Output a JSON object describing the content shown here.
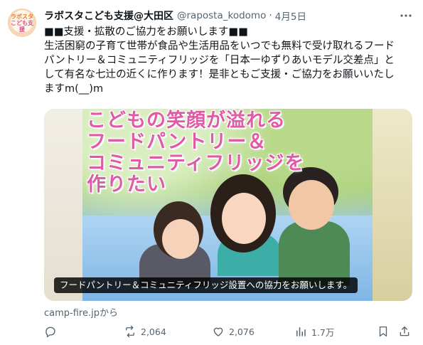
{
  "account": {
    "avatar_text_line1": "ラボスタ",
    "avatar_text_line2": "こども支援",
    "display_name": "ラボスタこども支援@大田区",
    "handle": "@raposta_kodomo",
    "separator": "·",
    "date": "4月5日"
  },
  "post": {
    "lines": [
      "■■支援・拡散のご協力をお願いします■■",
      "生活困窮の子育て世帯が食品や生活用品をいつでも無料で受け取れるフード",
      "パントリー＆コミュニティフリッジを「日本一ゆずりあいモデル交差点」と",
      "して有名な七辻の近くに作ります！是非ともご支援・ご協力をお願いいたし",
      "ますm(__)m"
    ]
  },
  "media": {
    "headline": "こどもの笑顔が溢れる\nフードパントリー＆\nコミュニティフリッジを\n作りたい",
    "caption": "フードパントリー＆コミュニティフリッジ設置への協力をお願いします。",
    "headline_color": "#e05ba6"
  },
  "source_text": "camp-fire.jpから",
  "actions": {
    "reply": {
      "icon": "reply-icon"
    },
    "retweet": {
      "icon": "retweet-icon",
      "count": "2,064"
    },
    "like": {
      "icon": "like-icon",
      "count": "2,076"
    },
    "views": {
      "icon": "views-icon",
      "count": "1.7万"
    },
    "bookmark": {
      "icon": "bookmark-icon"
    },
    "share": {
      "icon": "share-icon"
    }
  },
  "colors": {
    "text": "#0f1419",
    "secondary": "#536471"
  }
}
